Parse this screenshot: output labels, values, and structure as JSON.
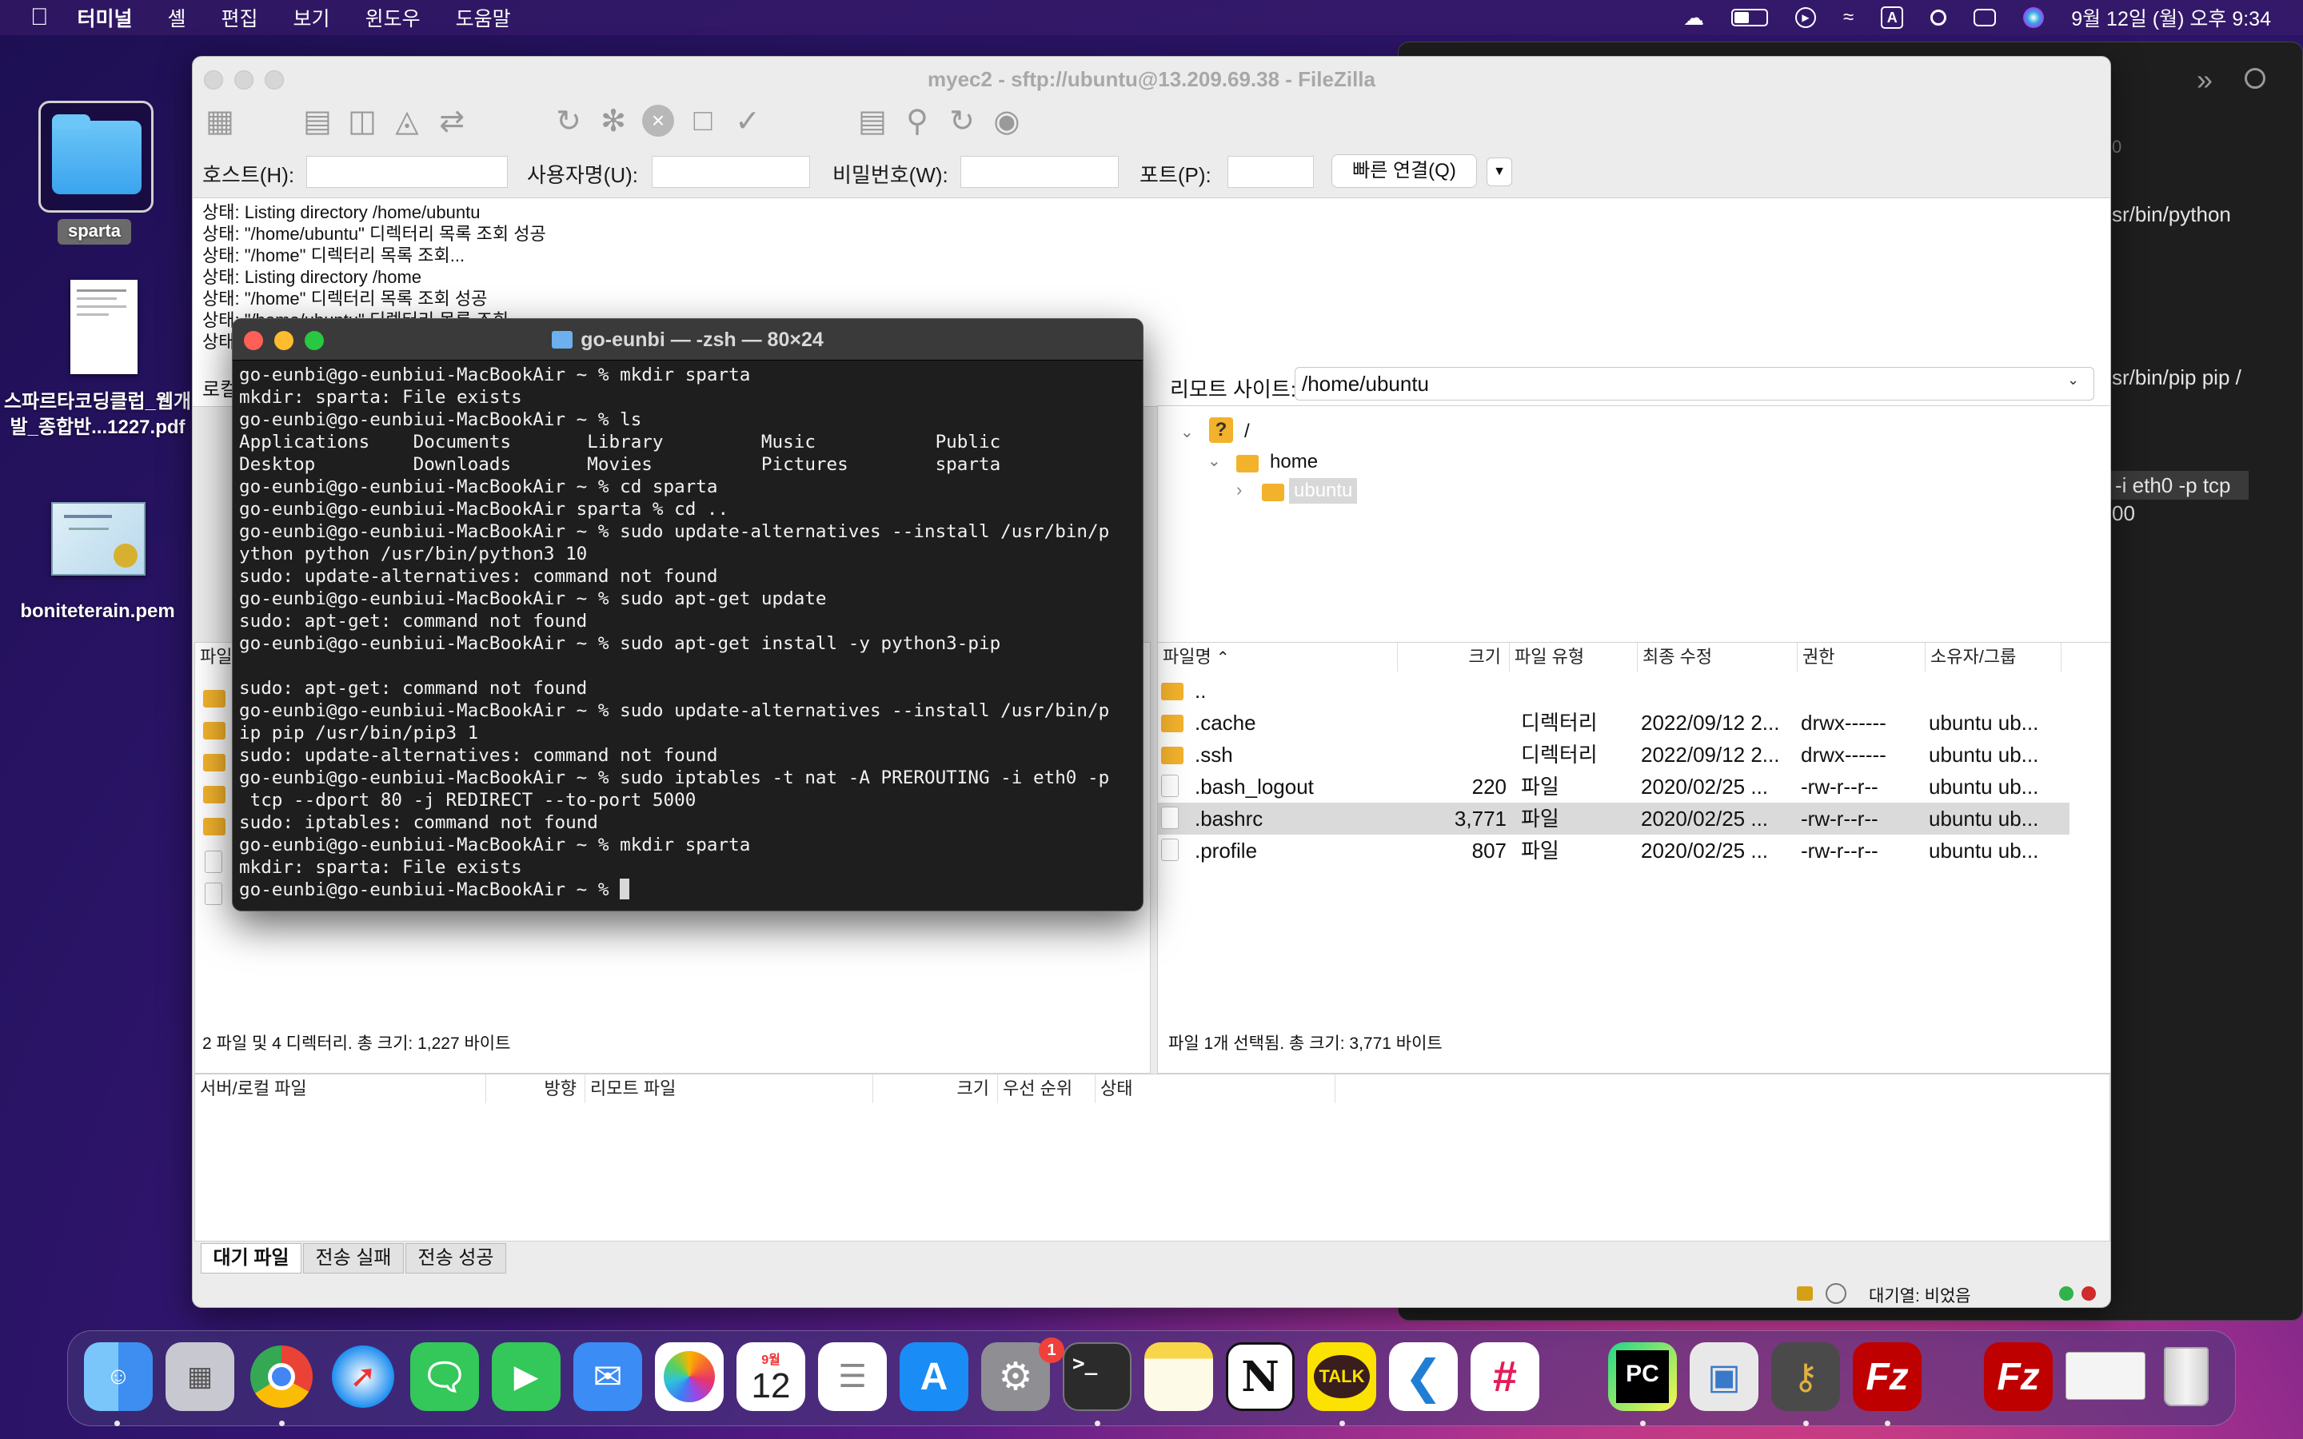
{
  "menubar": {
    "app": "터미널",
    "items": [
      "셸",
      "편집",
      "보기",
      "윈도우",
      "도움말"
    ],
    "input_source": "A",
    "clock": "9월 12일 (월) 오후 9:34"
  },
  "desktop": {
    "icons": [
      {
        "label": "sparta"
      },
      {
        "label": "스파르타코딩클럽_웹개발_종합반...1227.pdf"
      },
      {
        "label": "boniteterain.pem"
      }
    ],
    "pdf_label_line1": "스파르타코딩클럽_웹개",
    "pdf_label_line2": "발_종합반...1227.pdf"
  },
  "dark_window": {
    "lines": [
      "0",
      "sr/bin/python",
      "sr/bin/pip pip /",
      "-i eth0 -p tcp",
      "00"
    ]
  },
  "filezilla": {
    "title": "myec2 - sftp://ubuntu@13.209.69.38 - FileZilla",
    "quickconnect": {
      "host_label": "호스트(H):",
      "user_label": "사용자명(U):",
      "pass_label": "비밀번호(W):",
      "port_label": "포트(P):",
      "connect_button": "빠른 연결(Q)"
    },
    "log": [
      "상태:  Listing directory /home/ubuntu",
      "상태:  \"/home/ubuntu\" 디렉터리 목록 조회 성공",
      "상태:  \"/home\" 디렉터리 목록 조회...",
      "상태:  Listing directory /home",
      "상태:  \"/home\" 디렉터리 목록 조회 성공",
      "상태:  \"/home/ubuntu\" 디렉터리 목록 조회",
      "상태:"
    ],
    "local": {
      "site_label": "로컬 사이트:",
      "col_filename": "파일명",
      "status": "2 파일 및 4 디렉터리. 총 크기: 1,227 바이트"
    },
    "remote": {
      "site_label": "리모트 사이트:",
      "path": "/home/ubuntu",
      "tree": [
        "/",
        "home",
        "ubuntu"
      ],
      "columns": [
        "파일명",
        "크기",
        "파일 유형",
        "최종 수정",
        "권한",
        "소유자/그룹"
      ],
      "rows": [
        {
          "name": "..",
          "size": "",
          "type": "",
          "modified": "",
          "perm": "",
          "owner": ""
        },
        {
          "name": ".cache",
          "size": "",
          "type": "디렉터리",
          "modified": "2022/09/12 2...",
          "perm": "drwx------",
          "owner": "ubuntu ub..."
        },
        {
          "name": ".ssh",
          "size": "",
          "type": "디렉터리",
          "modified": "2022/09/12 2...",
          "perm": "drwx------",
          "owner": "ubuntu ub..."
        },
        {
          "name": ".bash_logout",
          "size": "220",
          "type": "파일",
          "modified": "2020/02/25 ...",
          "perm": "-rw-r--r--",
          "owner": "ubuntu ub..."
        },
        {
          "name": ".bashrc",
          "size": "3,771",
          "type": "파일",
          "modified": "2020/02/25 ...",
          "perm": "-rw-r--r--",
          "owner": "ubuntu ub..."
        },
        {
          "name": ".profile",
          "size": "807",
          "type": "파일",
          "modified": "2020/02/25 ...",
          "perm": "-rw-r--r--",
          "owner": "ubuntu ub..."
        }
      ],
      "selected_row": 4,
      "status": "파일 1개 선택됨. 총 크기: 3,771 바이트"
    },
    "queue": {
      "columns": [
        "서버/로컬 파일",
        "방향",
        "리모트 파일",
        "크기",
        "우선 순위",
        "상태"
      ],
      "tabs": [
        "대기 파일",
        "전송 실패",
        "전송 성공"
      ],
      "queue_status": "대기열: 비었음"
    }
  },
  "terminal": {
    "title": "go-eunbi — -zsh — 80×24",
    "lines": [
      "go-eunbi@go-eunbiui-MacBookAir ~ % mkdir sparta",
      "mkdir: sparta: File exists",
      "go-eunbi@go-eunbiui-MacBookAir ~ % ls",
      "Applications    Documents       Library         Music           Public",
      "Desktop         Downloads       Movies          Pictures        sparta",
      "go-eunbi@go-eunbiui-MacBookAir ~ % cd sparta",
      "go-eunbi@go-eunbiui-MacBookAir sparta % cd ..",
      "go-eunbi@go-eunbiui-MacBookAir ~ % sudo update-alternatives --install /usr/bin/p",
      "ython python /usr/bin/python3 10",
      "sudo: update-alternatives: command not found",
      "go-eunbi@go-eunbiui-MacBookAir ~ % sudo apt-get update",
      "sudo: apt-get: command not found",
      "go-eunbi@go-eunbiui-MacBookAir ~ % sudo apt-get install -y python3-pip",
      "",
      "sudo: apt-get: command not found",
      "go-eunbi@go-eunbiui-MacBookAir ~ % sudo update-alternatives --install /usr/bin/p",
      "ip pip /usr/bin/pip3 1",
      "sudo: update-alternatives: command not found",
      "go-eunbi@go-eunbiui-MacBookAir ~ % sudo iptables -t nat -A PREROUTING -i eth0 -p",
      " tcp --dport 80 -j REDIRECT --to-port 5000",
      "sudo: iptables: command not found",
      "go-eunbi@go-eunbiui-MacBookAir ~ % mkdir sparta",
      "mkdir: sparta: File exists",
      "go-eunbi@go-eunbiui-MacBookAir ~ % "
    ]
  },
  "dock": {
    "apps": [
      "Finder",
      "Launchpad",
      "Chrome",
      "Safari",
      "Messages",
      "FaceTime",
      "Mail",
      "Photos",
      "Calendar",
      "Reminders",
      "App Store",
      "System Preferences",
      "Terminal",
      "Notes",
      "Notion",
      "KakaoTalk",
      "VS Code",
      "Slack",
      "PyCharm",
      "Preview",
      "Keychain",
      "FileZilla",
      "FileZilla",
      "Window",
      "Trash"
    ],
    "calendar_month": "9월",
    "calendar_day": "12",
    "settings_badge": "1",
    "talk_label": "TALK",
    "pc_label": "PC",
    "notion_label": "N",
    "fz_label": "Fz",
    "terminal_label": ">_"
  },
  "colors": {
    "accent_blue": "#2f7cf6",
    "folder_yellow": "#f3b22c",
    "terminal_bg": "#1e1e1e",
    "close_red": "#fe5f57",
    "minimize_yellow": "#febc2e",
    "zoom_green": "#28c840"
  }
}
